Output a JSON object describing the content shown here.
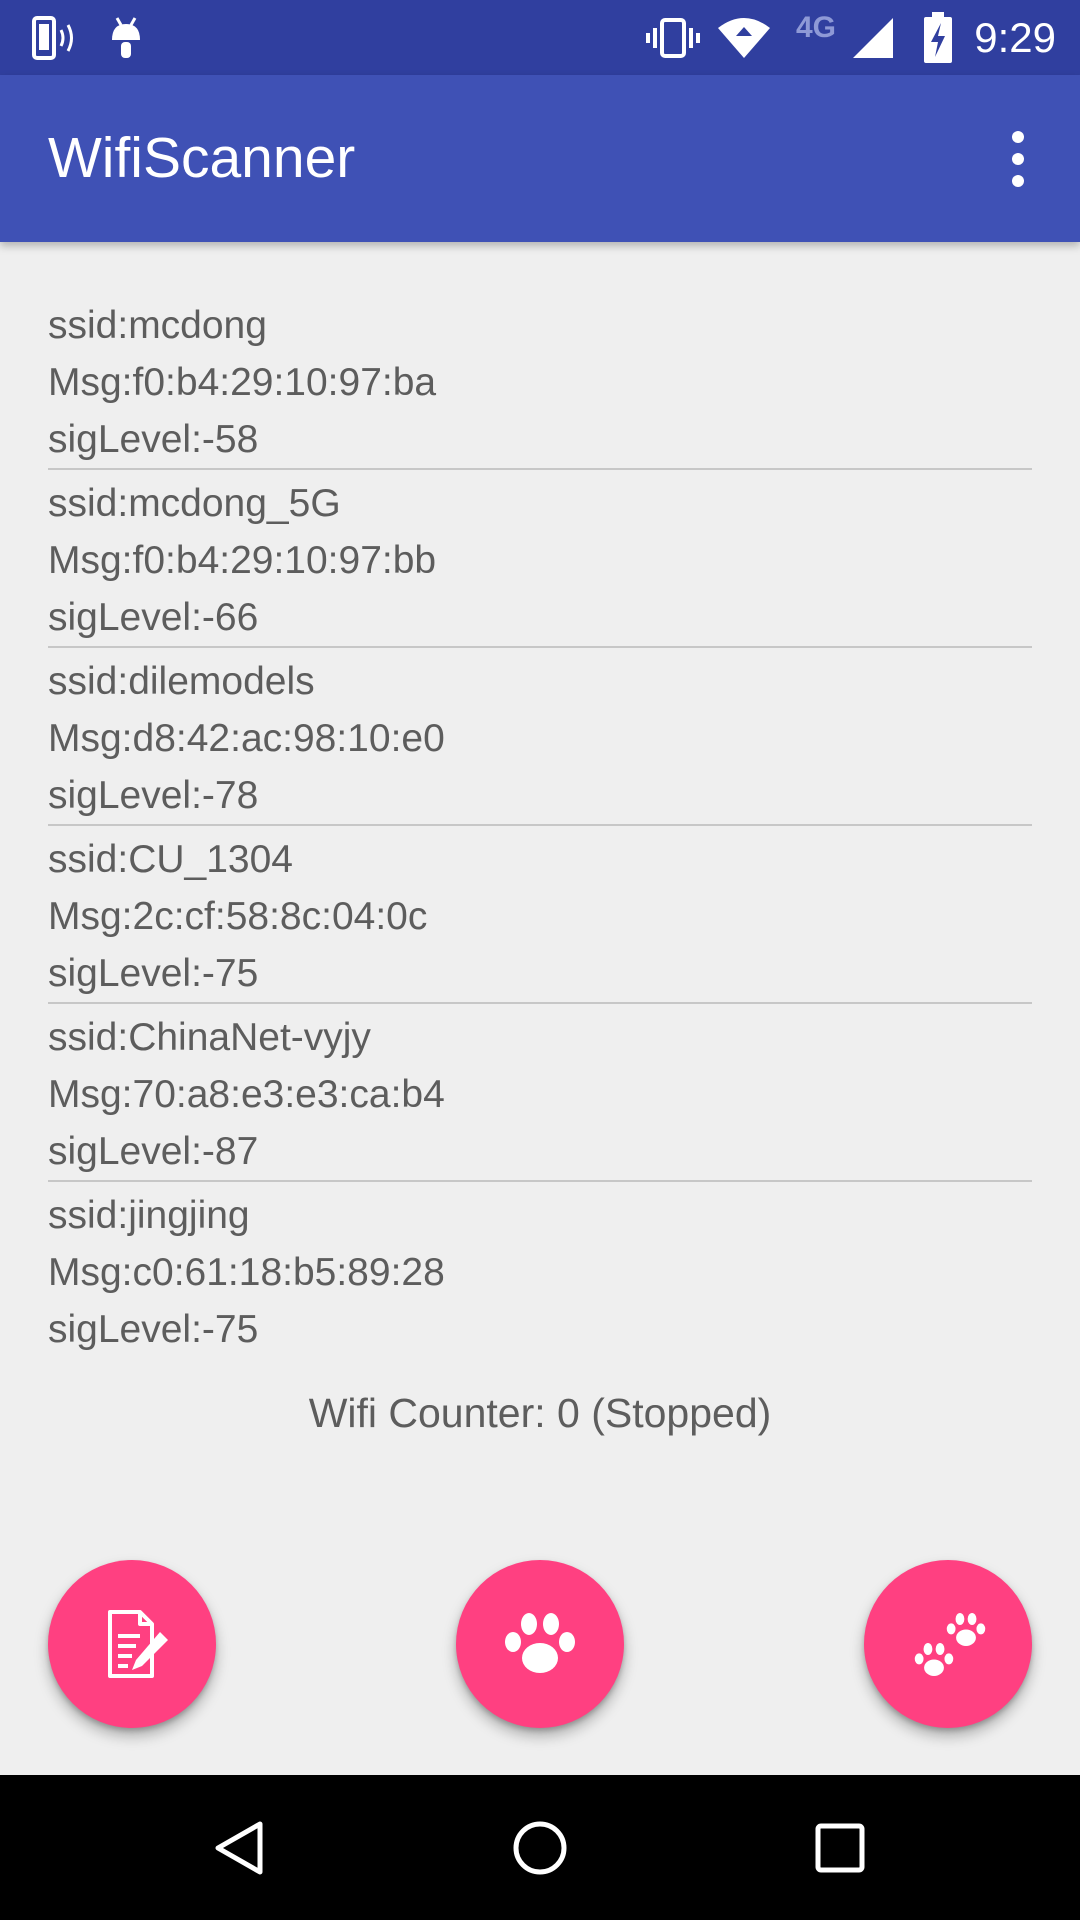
{
  "status_bar": {
    "time": "9:29",
    "network_label": "4G",
    "icons": [
      "phone-signal-icon",
      "android-debug-icon",
      "vibrate-icon",
      "wifi-icon",
      "cell-signal-icon",
      "battery-charging-icon"
    ]
  },
  "app_bar": {
    "title": "WifiScanner",
    "menu_icon": "more-vert-icon"
  },
  "wifi_list": [
    {
      "ssid": "ssid:mcdong",
      "msg": "Msg:f0:b4:29:10:97:ba",
      "level": "sigLevel:-58"
    },
    {
      "ssid": "ssid:mcdong_5G",
      "msg": "Msg:f0:b4:29:10:97:bb",
      "level": "sigLevel:-66"
    },
    {
      "ssid": "ssid:dilemodels",
      "msg": "Msg:d8:42:ac:98:10:e0",
      "level": "sigLevel:-78"
    },
    {
      "ssid": "ssid:CU_1304",
      "msg": "Msg:2c:cf:58:8c:04:0c",
      "level": "sigLevel:-75"
    },
    {
      "ssid": "ssid:ChinaNet-vyjy",
      "msg": "Msg:70:a8:e3:e3:ca:b4",
      "level": "sigLevel:-87"
    },
    {
      "ssid": "ssid:jingjing",
      "msg": "Msg:c0:61:18:b5:89:28",
      "level": "sigLevel:-75"
    }
  ],
  "counter": "Wifi Counter: 0 (Stopped)",
  "fabs": [
    {
      "icon": "note-edit-icon"
    },
    {
      "icon": "paw-icon"
    },
    {
      "icon": "double-paw-icon"
    }
  ],
  "nav_bar": {
    "icons": [
      "back-icon",
      "home-icon",
      "recents-icon"
    ]
  },
  "colors": {
    "status_bar": "#303f9f",
    "app_bar": "#3f51b5",
    "accent": "#ff4081",
    "background": "#efefef",
    "text": "#5d5d5d"
  }
}
